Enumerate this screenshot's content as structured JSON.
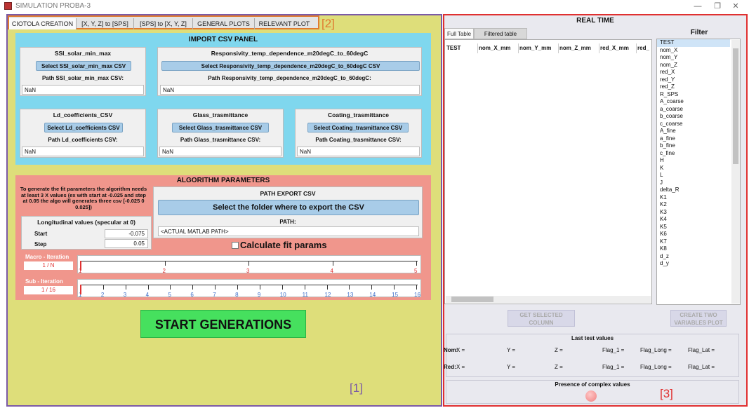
{
  "window": {
    "title": "SIMULATION PROBA-3"
  },
  "tabs": [
    "CIOTOLA CREATION",
    "[X, Y, Z] to [SPS]",
    "[SPS] to [X, Y, Z]",
    "GENERAL PLOTS",
    "RELEVANT PLOT"
  ],
  "annotations": {
    "a1": "[1]",
    "a2": "[2]",
    "a3": "[3]"
  },
  "import_panel": {
    "title": "IMPORT CSV PANEL",
    "boxes": [
      {
        "title": "SSI_solar_min_max",
        "button": "Select SSI_solar_min_max CSV",
        "path_label": "Path SSI_solar_min_max CSV:",
        "path_value": "NaN"
      },
      {
        "title": "Responsivity_temp_dependence_m20degC_to_60degC",
        "button": "Select Responsivity_temp_dependence_m20degC_to_60degC CSV",
        "path_label": "Path Responsivity_temp_dependence_m20degC_to_60degC:",
        "path_value": "NaN"
      },
      {
        "title": "Ld_coefficients_CSV",
        "button": "Select Ld_coefficients CSV",
        "path_label": "Path Ld_coefficients CSV:",
        "path_value": "NaN"
      },
      {
        "title": "Glass_trasmittance",
        "button": "Select Glass_trasmittance CSV",
        "path_label": "Path Glass_trasmittance CSV:",
        "path_value": "NaN"
      },
      {
        "title": "Coating_trasmittance",
        "button": "Select Coating_trasmittance CSV",
        "path_label": "Path Coating_trasmittance CSV:",
        "path_value": "NaN"
      }
    ]
  },
  "algo_panel": {
    "title": "ALGORITHM PARAMETERS",
    "note": "To generate the fit parameters the algorithm needs at least 3 X values (ex with start at -0.025 and step at 0.05 the algo will generates three csv [-0.025 0 0.025])",
    "long_title": "Longitudinal values (specular at 0)",
    "start_label": "Start",
    "start_value": "-0.075",
    "step_label": "Step",
    "step_value": "0.05",
    "path_export_title": "PATH EXPORT CSV",
    "folder_button": "Select the folder where to export the CSV",
    "path_label": "PATH:",
    "path_value": "<ACTUAL MATLAB PATH>",
    "calc_label": "Calculate fit params",
    "macro_label": "Macro - Iteration",
    "macro_value": "1 / N",
    "macro_ticks": [
      "1",
      "2",
      "3",
      "4",
      "5"
    ],
    "sub_label": "Sub - Iteration",
    "sub_value": "1 / 16",
    "sub_ticks": [
      "1",
      "2",
      "3",
      "4",
      "5",
      "6",
      "7",
      "8",
      "9",
      "10",
      "11",
      "12",
      "13",
      "14",
      "15",
      "16"
    ]
  },
  "start_button": "START GENERATIONS",
  "right": {
    "title": "REAL TIME",
    "table_tabs": [
      "Full Table",
      "Filtered table"
    ],
    "columns": [
      "TEST",
      "nom_X_mm",
      "nom_Y_mm",
      "nom_Z_mm",
      "red_X_mm",
      "red_"
    ],
    "filter_title": "Filter",
    "filter_items": [
      "TEST",
      "nom_X",
      "nom_Y",
      "nom_Z",
      "red_X",
      "red_Y",
      "red_Z",
      "R_SPS",
      "A_coarse",
      "a_coarse",
      "b_coarse",
      "c_coarse",
      "A_fine",
      "a_fine",
      "b_fine",
      "c_fine",
      "H",
      "K",
      "L",
      "J",
      "delta_R",
      "K1",
      "K2",
      "K3",
      "K4",
      "K5",
      "K6",
      "K7",
      "K8",
      "d_z",
      "d_y"
    ],
    "get_column_button": "GET SELECTED COLUMN",
    "two_vars_button": "CREATE TWO VARIABLES PLOT",
    "last_test_title": "Last test values",
    "nom_label": "Nom:",
    "red_label": "Red:",
    "fields": [
      "X =",
      "Y =",
      "Z =",
      "Flag_1 =",
      "Flag_Long =",
      "Flag_Lat ="
    ],
    "complex_title": "Presence of complex values"
  }
}
